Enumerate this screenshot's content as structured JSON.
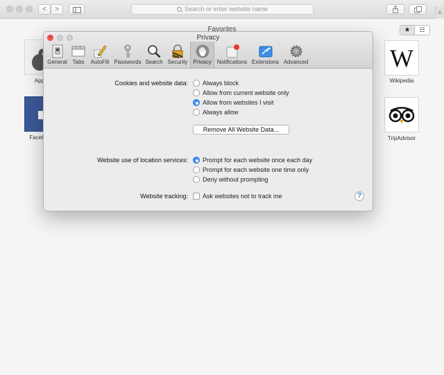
{
  "toolbar": {
    "back_glyph": "<",
    "forward_glyph": ">",
    "address_placeholder": "Search or enter website name",
    "new_tab_glyph": "+"
  },
  "favorites": {
    "title": "Favorites",
    "bookmarks_glyph": "★",
    "topsites_glyph": "☷",
    "tiles": [
      {
        "label": "Apple"
      },
      {
        "label": "Facebook"
      },
      {
        "label": "Wikipedia",
        "logo_text": "W"
      },
      {
        "label": "TripAdvisor"
      }
    ]
  },
  "prefs": {
    "title": "Privacy",
    "close_glyph": "×",
    "tabs": [
      {
        "label": "General",
        "icon": "general-switch-icon"
      },
      {
        "label": "Tabs",
        "icon": "tabs-window-icon"
      },
      {
        "label": "AutoFill",
        "icon": "pencil-icon"
      },
      {
        "label": "Passwords",
        "icon": "key-icon"
      },
      {
        "label": "Search",
        "icon": "magnifier-icon"
      },
      {
        "label": "Security",
        "icon": "padlock-icon"
      },
      {
        "label": "Privacy",
        "icon": "hand-icon"
      },
      {
        "label": "Notifications",
        "icon": "notification-badge-icon"
      },
      {
        "label": "Extensions",
        "icon": "puzzle-icon"
      },
      {
        "label": "Advanced",
        "icon": "gear-icon"
      }
    ],
    "active_tab": "Privacy",
    "cookies": {
      "label": "Cookies and website data:",
      "options": [
        "Always block",
        "Allow from current website only",
        "Allow from websites I visit",
        "Always allow"
      ],
      "selected": "Allow from websites I visit",
      "remove_button": "Remove All Website Data..."
    },
    "location": {
      "label": "Website use of location services:",
      "options": [
        "Prompt for each website once each day",
        "Prompt for each website one time only",
        "Deny without prompting"
      ],
      "selected": "Prompt for each website once each day"
    },
    "tracking": {
      "label": "Website tracking:",
      "checkbox": "Ask websites not to track me",
      "checked": false
    },
    "help_glyph": "?"
  },
  "colors": {
    "accent": "#3e8ff5",
    "close_red": "#fc5b57",
    "facebook_blue": "#3b5998"
  }
}
